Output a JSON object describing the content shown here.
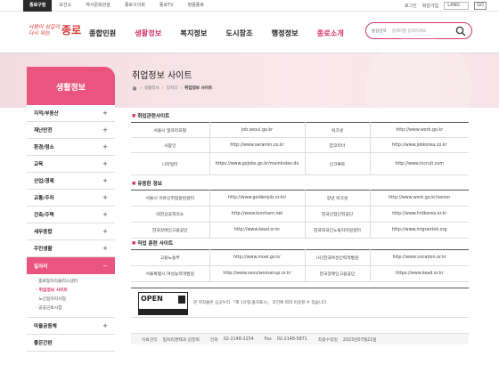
{
  "topbar": {
    "links": [
      "종로구청",
      "보건소",
      "역사문화관광",
      "종로구의회",
      "종로TV",
      "청렴종로"
    ],
    "login": "로그인",
    "join": "회원가입",
    "lang": "LANG",
    "go": "GO"
  },
  "logo": {
    "slogan_line1": "사람이 섬길이",
    "slogan_line2": "다시 뛰는",
    "name": "종로"
  },
  "gnb": [
    "종합민원",
    "생활정보",
    "복지정보",
    "도시창조",
    "행정정보",
    "종로소개"
  ],
  "search": {
    "scope": "통합검색",
    "placeholder": "검색어를 입력하세요."
  },
  "sidebar": {
    "title": "생활정보",
    "items": [
      {
        "label": "지적/부동산",
        "mark": "+"
      },
      {
        "label": "재난안전",
        "mark": "+"
      },
      {
        "label": "환경/청소",
        "mark": "+"
      },
      {
        "label": "교육",
        "mark": "+"
      },
      {
        "label": "산업/경제",
        "mark": "+"
      },
      {
        "label": "교통/주차",
        "mark": "+"
      },
      {
        "label": "건축/주택",
        "mark": "+"
      },
      {
        "label": "세무종합",
        "mark": "+"
      },
      {
        "label": "주민생활",
        "mark": "+"
      },
      {
        "label": "일자리",
        "mark": "−"
      }
    ],
    "sub": [
      "종로일자리플러스센터",
      "취업정보 사이트",
      "노인일자리사업",
      "공공근로사업"
    ],
    "after": [
      {
        "label": "마을공동체",
        "mark": "+"
      },
      {
        "label": "좋은간판",
        "mark": ""
      }
    ]
  },
  "content": {
    "title": "취업정보 사이트",
    "breadcrumb": [
      "생활정보",
      "일자리",
      "취업정보 사이트"
    ],
    "sections": [
      {
        "title": "취업관련사이트",
        "rows": [
          [
            "서울시 일자리포털",
            "job.seoul.go.kr",
            "워크넷",
            "http://www.work.go.kr"
          ],
          [
            "사람인",
            "http://www.saramin.co.kr",
            "잡코리아",
            "http://www.jobkorea.co.kr"
          ],
          [
            "나라일터",
            "https://www.gojobs.go.kr/mainIndex.do",
            "인크루트",
            "http://www.incruit.com"
          ]
        ]
      },
      {
        "title": "유용한 정보",
        "rows": [
          [
            "서울시 어르신취업훈련센터",
            "http://www.goldenjob.or.kr/",
            "장년 워크넷",
            "http://www.work.go.kr/senior"
          ],
          [
            "대한상공회의소",
            "http://www.korcham.net",
            "한국산업인력공단",
            "http://www.hrdkorea.or.kr"
          ],
          [
            "한국장애인고용공단",
            "http://www.kead.or.kr",
            "한국외국인노동자지원센터",
            "http://www.migrantok.org"
          ]
        ]
      },
      {
        "title": "직업 훈련 사이트",
        "rows": [
          [
            "고용노동부",
            "http://www.moel.go.kr",
            "(사)한국여성인력개발원",
            "http://www.vocation.or.kr"
          ],
          [
            "서울특별시 여성능력개발원",
            "http://www.seoulwomanup.or.kr",
            "한국장애인고용공단",
            "https://www.kead.or.kr"
          ]
        ]
      }
    ],
    "license": {
      "logo_text": "OPEN",
      "notice": "본 저작물은 공공누리 「제 1유형:출처표시」 조건에 따라 이용할 수 있습니다."
    },
    "footer": {
      "owner_label": "자료관리",
      "owner_value": "일자리경제과 김한희",
      "tel_label": "전화",
      "tel_value": "02-2148-2254",
      "fax_label": "Fax",
      "fax_value": "02-2148-5871",
      "updated_label": "최종수정일",
      "updated_value": "2023년07월21일"
    }
  },
  "colors": {
    "accent": "#d6336c",
    "sidebar_title": "#e9557e",
    "band": "#f7e5ea"
  }
}
